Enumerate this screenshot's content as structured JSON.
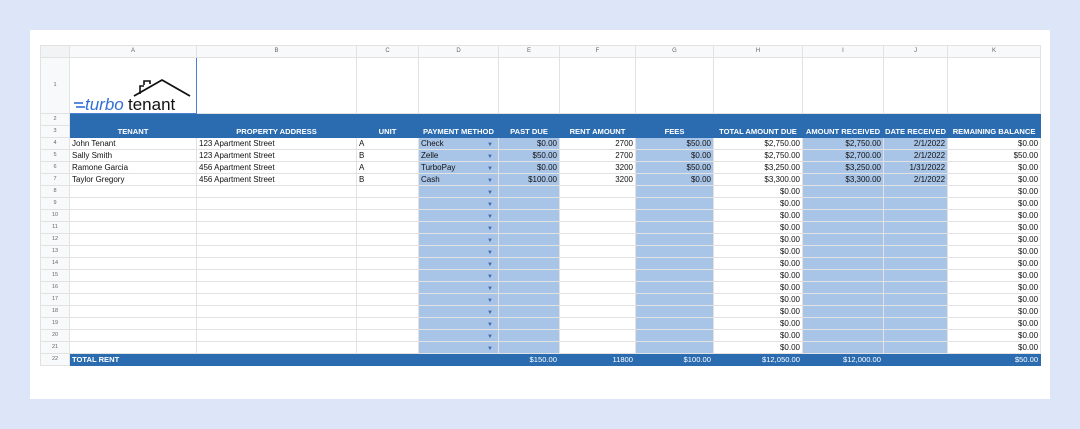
{
  "columns": [
    "A",
    "B",
    "C",
    "D",
    "E",
    "F",
    "G",
    "H",
    "I",
    "J",
    "K"
  ],
  "row_numbers": [
    "1",
    "2",
    "3",
    "4",
    "5",
    "6",
    "7",
    "8",
    "9",
    "10",
    "11",
    "12",
    "13",
    "14",
    "15",
    "16",
    "17",
    "18",
    "19",
    "20",
    "21",
    "22"
  ],
  "logo": {
    "text_prefix": "turbo",
    "text_suffix": "tenant",
    "icon": "house-roof-icon"
  },
  "headers": [
    "TENANT",
    "PROPERTY ADDRESS",
    "UNIT",
    "PAYMENT METHOD",
    "PAST DUE",
    "RENT AMOUNT",
    "FEES",
    "TOTAL AMOUNT DUE",
    "AMOUNT RECEIVED",
    "DATE RECEIVED",
    "REMAINING BALANCE"
  ],
  "rows": [
    {
      "tenant": "John Tenant",
      "address": "123 Apartment Street",
      "unit": "A",
      "method": "Check",
      "past_due": "$0.00",
      "rent": "2700",
      "fees": "$50.00",
      "total_due": "$2,750.00",
      "received": "$2,750.00",
      "date": "2/1/2022",
      "balance": "$0.00"
    },
    {
      "tenant": "Sally Smith",
      "address": "123 Apartment Street",
      "unit": "B",
      "method": "Zelle",
      "past_due": "$50.00",
      "rent": "2700",
      "fees": "$0.00",
      "total_due": "$2,750.00",
      "received": "$2,700.00",
      "date": "2/1/2022",
      "balance": "$50.00"
    },
    {
      "tenant": "Ramone Garcia",
      "address": "456 Apartment Street",
      "unit": "A",
      "method": "TurboPay",
      "past_due": "$0.00",
      "rent": "3200",
      "fees": "$50.00",
      "total_due": "$3,250.00",
      "received": "$3,250.00",
      "date": "1/31/2022",
      "balance": "$0.00"
    },
    {
      "tenant": "Taylor Gregory",
      "address": "456 Apartment Street",
      "unit": "B",
      "method": "Cash",
      "past_due": "$100.00",
      "rent": "3200",
      "fees": "$0.00",
      "total_due": "$3,300.00",
      "received": "$3,300.00",
      "date": "2/1/2022",
      "balance": "$0.00"
    }
  ],
  "empty_rows": {
    "count": 14,
    "total_due": "$0.00",
    "balance": "$0.00"
  },
  "totals": {
    "label": "TOTAL RENT",
    "past_due": "$150.00",
    "rent": "11800",
    "fees": "$100.00",
    "total_due": "$12,050.00",
    "received": "$12,000.00",
    "balance": "$50.00"
  },
  "colors": {
    "header_blue": "#2b6cb0",
    "shaded_column": "#a8c4e6",
    "logo_blue": "#2f6fd6",
    "page_background": "#dce6f8"
  }
}
